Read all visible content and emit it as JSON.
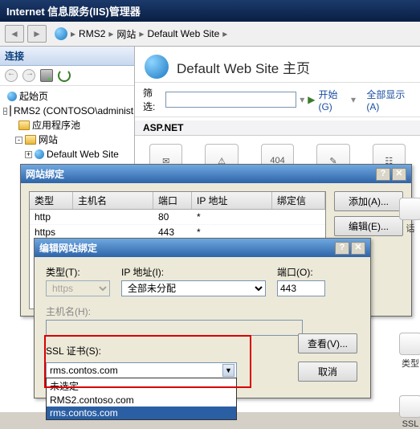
{
  "window": {
    "title": "Internet 信息服务(IIS)管理器"
  },
  "breadcrumb": {
    "root": "RMS2",
    "level2": "网站",
    "level3": "Default Web Site"
  },
  "sidebar": {
    "header": "连接",
    "tree": {
      "start": "起始页",
      "server": "RMS2 (CONTOSO\\administrato",
      "pools": "应用程序池",
      "sites": "网站",
      "default_site": "Default Web Site"
    }
  },
  "main": {
    "title": "Default Web Site 主页",
    "filter_label": "筛选:",
    "filter_value": "",
    "start_label": "开始(G)",
    "show_all": "全部显示(A)",
    "group_aspnet": "ASP.NET"
  },
  "right_icons": {
    "talk": "话",
    "leixing": "类型",
    "ssl": "SSL"
  },
  "dlg_bindings": {
    "title": "网站绑定",
    "cols": {
      "type": "类型",
      "host": "主机名",
      "port": "端口",
      "ip": "IP 地址",
      "bind": "绑定信"
    },
    "rows": [
      {
        "type": "http",
        "host": "",
        "port": "80",
        "ip": "*",
        "bind": ""
      },
      {
        "type": "https",
        "host": "",
        "port": "443",
        "ip": "*",
        "bind": ""
      }
    ],
    "buttons": {
      "add": "添加(A)...",
      "edit": "编辑(E)..."
    }
  },
  "dlg_edit": {
    "title": "编辑网站绑定",
    "type_label": "类型(T):",
    "type_value": "https",
    "ip_label": "IP 地址(I):",
    "ip_value": "全部未分配",
    "port_label": "端口(O):",
    "port_value": "443",
    "hostname_label": "主机名(H):",
    "hostname_value": "",
    "ssl_label": "SSL 证书(S):",
    "ssl_selected": "rms.contos.com",
    "ssl_options": [
      "未选定",
      "RMS2.contoso.com",
      "rms.contos.com"
    ],
    "view_btn": "查看(V)...",
    "cancel_btn": "取消"
  }
}
